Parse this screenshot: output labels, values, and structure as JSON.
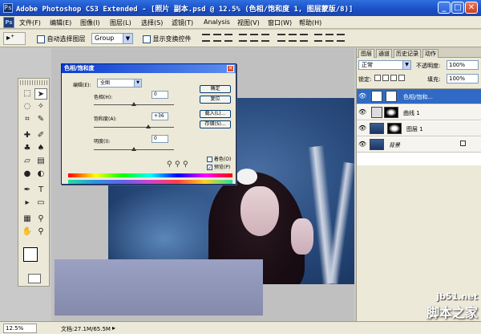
{
  "window": {
    "title": "Adobe Photoshop CS3 Extended - [照片 副本.psd @ 12.5% (色相/饱和度 1, 图层蒙版/8)]",
    "app_icon": "Ps",
    "minimize": "_",
    "maximize": "□",
    "close": "✕"
  },
  "menubar": {
    "logo": "Ps",
    "items": [
      "文件(F)",
      "编辑(E)",
      "图像(I)",
      "图层(L)",
      "选择(S)",
      "滤镜(T)",
      "Analysis",
      "视图(V)",
      "窗口(W)",
      "帮助(H)"
    ]
  },
  "options": {
    "tool_preset": "▸⁺",
    "auto_select_label": "自动选择图层",
    "auto_select_value": "Group",
    "show_transform_label": "显示变换控件"
  },
  "dialog": {
    "title": "色相/饱和度",
    "edit_label": "编辑(E):",
    "edit_value": "全图",
    "hue_label": "色相(H):",
    "hue_value": "0",
    "saturation_label": "饱和度(A):",
    "saturation_value": "+36",
    "lightness_label": "明度(I):",
    "lightness_value": "0",
    "ok": "确定",
    "cancel": "复位",
    "load": "载入(L)...",
    "save": "存储(S)...",
    "colorize": "着色(O)",
    "preview": "预览(P)",
    "hue_level": 0.5,
    "saturation_level": 0.68,
    "lightness_level": 0.5
  },
  "panel": {
    "tabs": [
      "图层",
      "通道",
      "历史记录",
      "动作"
    ],
    "blend_mode": "正常",
    "opacity_label": "不透明度:",
    "opacity_value": "100%",
    "lock_label": "锁定:",
    "fill_label": "填充:",
    "fill_value": "100%",
    "layers": [
      {
        "name": "色相/饱和...",
        "selected": true
      },
      {
        "name": "曲线 1",
        "selected": false
      },
      {
        "name": "图层 1",
        "selected": false
      },
      {
        "name": "背景",
        "selected": false
      }
    ]
  },
  "status": {
    "zoom": "12.5%",
    "doc": "文档:27.1M/65.5M"
  },
  "watermark": {
    "site": "jb51.net",
    "name": "脚本之家"
  }
}
